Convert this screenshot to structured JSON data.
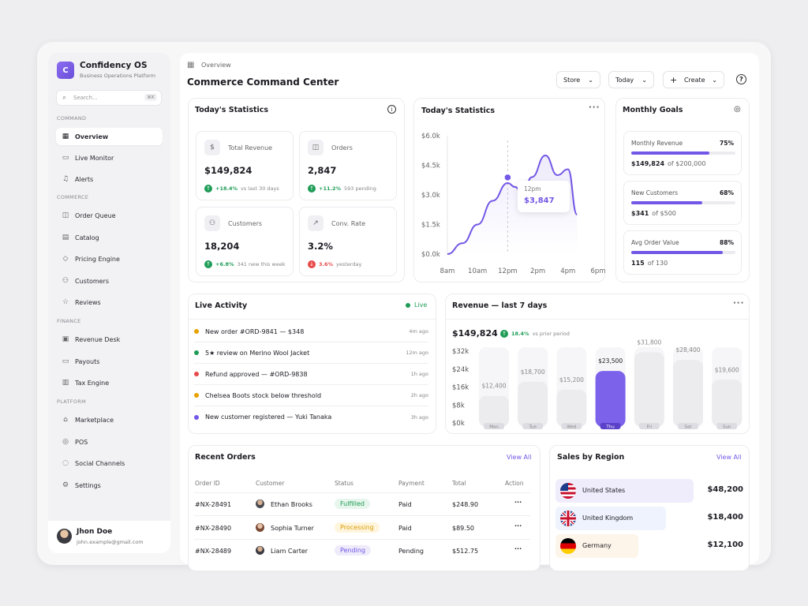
{
  "brand": {
    "logo_letter": "C",
    "name": "Confidency OS",
    "subtitle": "Business Operations Platform"
  },
  "search": {
    "placeholder": "Search...",
    "shortcut": "⌘K"
  },
  "sidebar": {
    "sections": [
      {
        "label": "COMMAND",
        "items": [
          {
            "label": "Overview",
            "icon": "grid-icon",
            "active": true
          },
          {
            "label": "Live Monitor",
            "icon": "monitor-icon"
          },
          {
            "label": "Alerts",
            "icon": "bell-icon"
          }
        ]
      },
      {
        "label": "COMMERCE",
        "items": [
          {
            "label": "Order Queue",
            "icon": "bag-icon"
          },
          {
            "label": "Catalog",
            "icon": "book-icon"
          },
          {
            "label": "Pricing Engine",
            "icon": "tag-icon"
          },
          {
            "label": "Customers",
            "icon": "users-icon"
          },
          {
            "label": "Reviews",
            "icon": "star-icon"
          }
        ]
      },
      {
        "label": "FINANCE",
        "items": [
          {
            "label": "Revenue Desk",
            "icon": "wallet-icon"
          },
          {
            "label": "Payouts",
            "icon": "card-icon"
          },
          {
            "label": "Tax Engine",
            "icon": "receipt-icon"
          }
        ]
      },
      {
        "label": "PLATFORM",
        "items": [
          {
            "label": "Marketplace",
            "icon": "store-icon"
          },
          {
            "label": "POS",
            "icon": "pos-icon"
          },
          {
            "label": "Social Channels",
            "icon": "share-icon"
          },
          {
            "label": "Settings",
            "icon": "gear-icon"
          }
        ]
      }
    ]
  },
  "user": {
    "name": "Jhon Doe",
    "email": "john.example@gmail.com"
  },
  "header": {
    "breadcrumb": "Overview",
    "title": "Commerce Command Center",
    "store": "Store",
    "period": "Today",
    "create": "Create"
  },
  "stats": {
    "title": "Today's Statistics",
    "cards": [
      {
        "label": "Total Revenue",
        "value": "$149,824",
        "delta": "+18.4%",
        "note": "vs last 30 days",
        "dir": "up",
        "icon": "money-icon"
      },
      {
        "label": "Orders",
        "value": "2,847",
        "delta": "+11.2%",
        "note": "593 pending",
        "dir": "up",
        "icon": "bag-icon"
      },
      {
        "label": "Customers",
        "value": "18,204",
        "delta": "+6.8%",
        "note": "341 new this week",
        "dir": "up",
        "icon": "users-icon"
      },
      {
        "label": "Conv. Rate",
        "value": "3.2%",
        "delta": "3.6%",
        "note": "yesterday",
        "dir": "down",
        "icon": "trend-icon"
      }
    ]
  },
  "line_card": {
    "title": "Today's Statistics",
    "tooltip_time": "12pm",
    "tooltip_value": "$3,847"
  },
  "goals": {
    "title": "Monthly Goals",
    "items": [
      {
        "label": "Monthly Revenue",
        "percent": "75%",
        "fill": 0.75,
        "value": "$149,824",
        "target": "of $200,000"
      },
      {
        "label": "New Customers",
        "percent": "68%",
        "fill": 0.68,
        "value": "$341",
        "target": "of $500"
      },
      {
        "label": "Avg Order Value",
        "percent": "88%",
        "fill": 0.88,
        "value": "115",
        "target": "of 130"
      }
    ]
  },
  "activity": {
    "title": "Live Activity",
    "status": "Live",
    "items": [
      {
        "text": "New order #ORD-9841 — $348",
        "time": "4m ago",
        "color": "#e9a100"
      },
      {
        "text": "5★ review on Merino Wool Jacket",
        "time": "12m ago",
        "color": "#1f9d57"
      },
      {
        "text": "Refund approved — #ORD-9838",
        "time": "1h ago",
        "color": "#e84a4a"
      },
      {
        "text": "Chelsea Boots stock below threshold",
        "time": "2h ago",
        "color": "#e9a100"
      },
      {
        "text": "New customer registered — Yuki Tanaka",
        "time": "3h ago",
        "color": "#7357e6"
      }
    ]
  },
  "revenue": {
    "title": "Revenue — last 7 days",
    "total": "$149,824",
    "delta": "18.4%",
    "note": "vs prior period"
  },
  "chart_data": [
    {
      "type": "line",
      "title": "Today's Statistics",
      "x": [
        "8am",
        "10am",
        "12pm",
        "2pm",
        "4pm",
        "6pm"
      ],
      "y_ticks": [
        "$6.0k",
        "$4.5k",
        "$3.0k",
        "$1.5k",
        "$0.0k"
      ],
      "ylim": [
        0,
        6000
      ],
      "points": [
        [
          8,
          0
        ],
        [
          9,
          550
        ],
        [
          10,
          1500
        ],
        [
          11,
          2700
        ],
        [
          12,
          3600
        ],
        [
          12.5,
          3400
        ],
        [
          13,
          3000
        ],
        [
          13.6,
          3900
        ],
        [
          14.5,
          5000
        ],
        [
          15.3,
          4000
        ],
        [
          16,
          4300
        ],
        [
          16.6,
          2000
        ]
      ],
      "highlight": {
        "x": "12pm",
        "value": 3847
      }
    },
    {
      "type": "bar",
      "title": "Revenue — last 7 days",
      "categories": [
        "Mon",
        "Tue",
        "Wed",
        "Thu",
        "Fri",
        "Sat",
        "Sun"
      ],
      "values": [
        12400,
        18700,
        15200,
        23500,
        31800,
        28400,
        19600
      ],
      "labels": [
        "$12,400",
        "$18,700",
        "$15,200",
        "$23,500",
        "$31,800",
        "$28,400",
        "$19,600"
      ],
      "y_ticks": [
        "$32k",
        "$24k",
        "$16k",
        "$8k",
        "$0k"
      ],
      "ylim": [
        0,
        32000
      ],
      "highlight": "Thu"
    }
  ],
  "orders": {
    "title": "Recent Orders",
    "view_all": "View All",
    "columns": [
      "Order ID",
      "Customer",
      "Status",
      "Payment",
      "Total",
      "Action"
    ],
    "rows": [
      {
        "id": "#NX-28491",
        "customer": "Ethan Brooks",
        "status": "Fulfilled",
        "payment": "Paid",
        "total": "$248.90",
        "bg": "#e6f6ec",
        "fg": "#1f9d57"
      },
      {
        "id": "#NX-28490",
        "customer": "Sophia Turner",
        "status": "Processing",
        "payment": "Paid",
        "total": "$89.50",
        "bg": "#fff5dc",
        "fg": "#d99a00"
      },
      {
        "id": "#NX-28489",
        "customer": "Liam Carter",
        "status": "Pending",
        "payment": "Pending",
        "total": "$512.75",
        "bg": "#eeebfb",
        "fg": "#7357e6"
      }
    ]
  },
  "regions": {
    "title": "Sales by Region",
    "view_all": "View All",
    "items": [
      {
        "name": "United States",
        "value": "$48,200",
        "share": 1.0,
        "bg": "#efedfc"
      },
      {
        "name": "United Kingdom",
        "value": "$18,400",
        "share": 0.8,
        "bg": "#eef3fd"
      },
      {
        "name": "Germany",
        "value": "$12,100",
        "share": 0.6,
        "bg": "#fdf5ea"
      }
    ]
  }
}
